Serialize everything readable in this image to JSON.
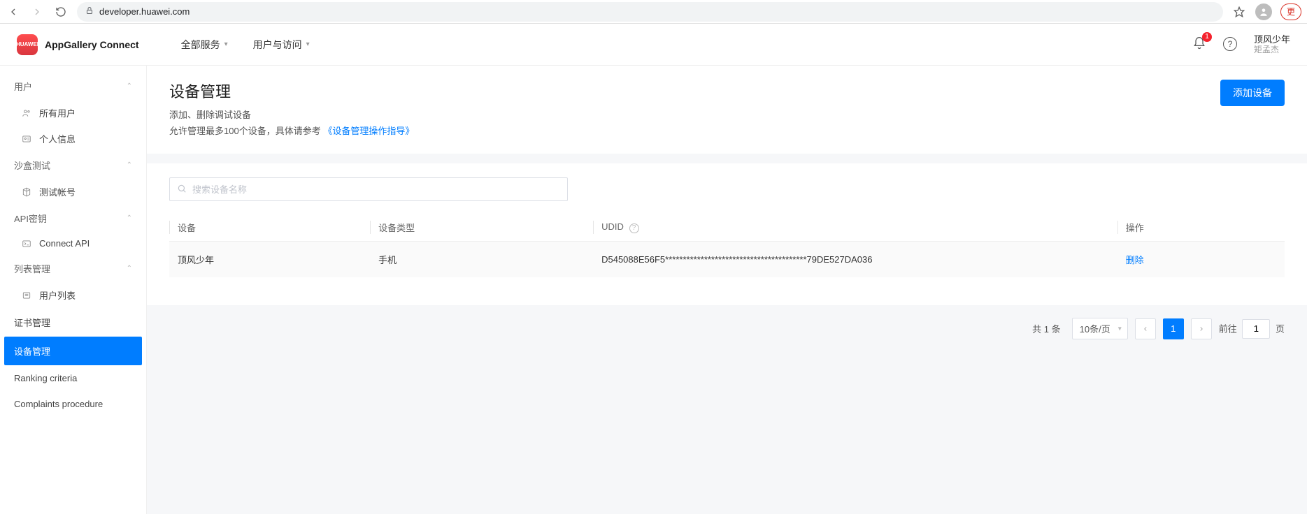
{
  "browser": {
    "url": "developer.huawei.com",
    "overflow_label": "更"
  },
  "header": {
    "logo_small": "HUAWEI",
    "logo_text": "AppGallery Connect",
    "menu": {
      "all_services": "全部服务",
      "users_access": "用户与访问"
    },
    "notification_count": "1",
    "user": {
      "name": "顶风少年",
      "sub": "矩孟杰"
    }
  },
  "sidebar": {
    "groups": {
      "user": {
        "label": "用户",
        "items": {
          "all_users": "所有用户",
          "profile": "个人信息"
        }
      },
      "sandbox": {
        "label": "沙盒测试",
        "items": {
          "test_account": "测试帐号"
        }
      },
      "api_key": {
        "label": "API密钥",
        "items": {
          "connect_api": "Connect API"
        }
      },
      "list_mgmt": {
        "label": "列表管理",
        "items": {
          "user_list": "用户列表"
        }
      }
    },
    "plain": {
      "cert_mgmt": "证书管理",
      "device_mgmt": "设备管理",
      "ranking": "Ranking criteria",
      "complaints": "Complaints procedure"
    }
  },
  "page": {
    "title": "设备管理",
    "subtitle": "添加、删除调试设备",
    "desc_prefix": "允许管理最多100个设备，具体请参考 ",
    "desc_link": "《设备管理操作指导》",
    "add_button": "添加设备",
    "search_placeholder": "搜索设备名称"
  },
  "table": {
    "headers": {
      "device": "设备",
      "type": "设备类型",
      "udid": "UDID",
      "action": "操作"
    },
    "rows": [
      {
        "device": "顶风少年",
        "type": "手机",
        "udid": "D545088E56F5****************************************79DE527DA036",
        "action": "删除"
      }
    ]
  },
  "pager": {
    "total_prefix": "共 ",
    "total_count": "1",
    "total_suffix": " 条",
    "page_size": "10条/页",
    "current": "1",
    "jump_prefix": "前往",
    "jump_value": "1",
    "jump_suffix": "页"
  }
}
